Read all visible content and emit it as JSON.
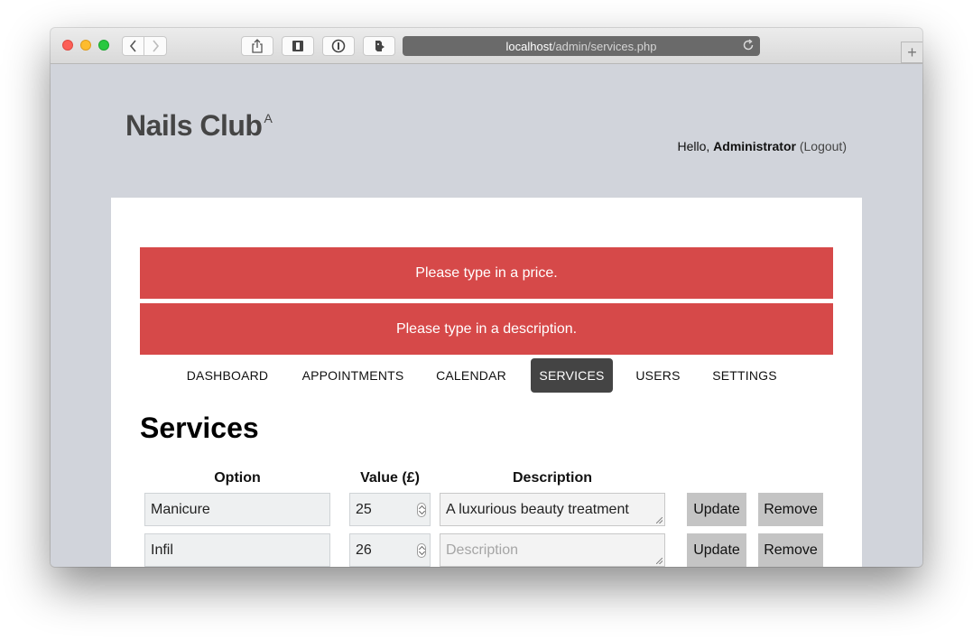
{
  "browser": {
    "url_host": "localhost",
    "url_path": "/admin/services.php"
  },
  "site": {
    "logo_text": "Nails Club",
    "logo_sup": "A"
  },
  "user": {
    "hello": "Hello,",
    "name": "Administrator",
    "logout": "(Logout)"
  },
  "alerts": [
    "Please type in a price.",
    "Please type in a description."
  ],
  "nav": [
    {
      "label": "DASHBOARD",
      "active": false
    },
    {
      "label": "APPOINTMENTS",
      "active": false
    },
    {
      "label": "CALENDAR",
      "active": false
    },
    {
      "label": "SERVICES",
      "active": true
    },
    {
      "label": "USERS",
      "active": false
    },
    {
      "label": "SETTINGS",
      "active": false
    }
  ],
  "page_title": "Services",
  "table": {
    "headers": [
      "Option",
      "Value (£)",
      "Description"
    ],
    "rows": [
      {
        "option": "Manicure",
        "value": "25",
        "description": "A luxurious beauty treatment",
        "description_placeholder": "Description"
      },
      {
        "option": "Infil",
        "value": "26",
        "description": "",
        "description_placeholder": "Description"
      }
    ],
    "update_label": "Update",
    "remove_label": "Remove"
  },
  "colors": {
    "alert": "#d64949",
    "nav_active": "#444444",
    "background": "#d1d4db"
  }
}
